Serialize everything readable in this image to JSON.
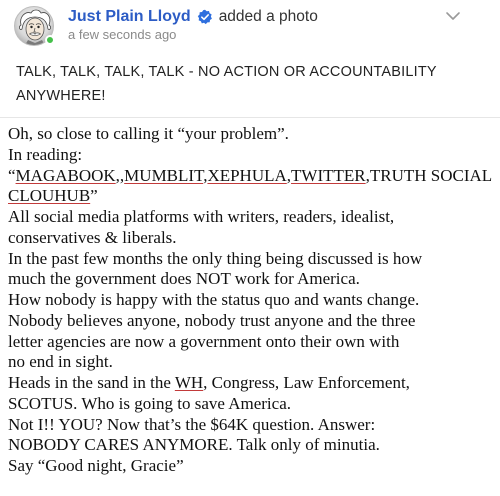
{
  "post": {
    "author": "Just Plain Lloyd",
    "action": "added a photo",
    "timestamp": "a few seconds ago",
    "title_line1": "TALK, TALK, TALK, TALK - NO ACTION OR ACCOUNTABILITY",
    "title_line2": "ANYWHERE!"
  },
  "body": {
    "l1": "Oh, so close to calling it “your problem”.",
    "l2": "In reading:",
    "l3_prefix": "“",
    "l3_u1": "MAGABOOK",
    "l3_sep1": ",,",
    "l3_u2": "MUMBLIT",
    "l3_sep2": ",",
    "l3_u3": "XEPHULA",
    "l3_sep3": ",",
    "l3_u4": "TWITTER",
    "l3_rest": ",TRUTH SOCIAL",
    "l4_u": "CLOUHUB",
    "l4_rest": "”",
    "l5": "All social media platforms with writers, readers, idealist,",
    "l6": "conservatives & liberals.",
    "l7": "In the past few months the only thing being discussed is how",
    "l8": "much the government does NOT work for America.",
    "l9": "How nobody is happy with the status quo and wants change.",
    "l10": "Nobody believes anyone, nobody trust anyone and the three",
    "l11": "letter agencies are now a government onto their own with",
    "l12": "no end in sight.",
    "l13_prefix": "Heads in the sand in the ",
    "l13_u": "WH",
    "l13_rest": ", Congress, Law Enforcement,",
    "l14": "SCOTUS. Who is going to save America.",
    "l15": "Not I!! YOU? Now that’s the $64K question. Answer:",
    "l16": "NOBODY CARES ANYMORE. Talk only of minutia.",
    "l17": "Say “Good night, Gracie”"
  },
  "colors": {
    "author": "#2c5cc5",
    "verified": "#2f6fde",
    "online": "#45c04a",
    "spell_underline": "#c23a3a"
  },
  "icons": {
    "verified": "verified-badge-icon",
    "chevron": "chevron-down-icon",
    "avatar": "cartoon-portrait-avatar"
  }
}
